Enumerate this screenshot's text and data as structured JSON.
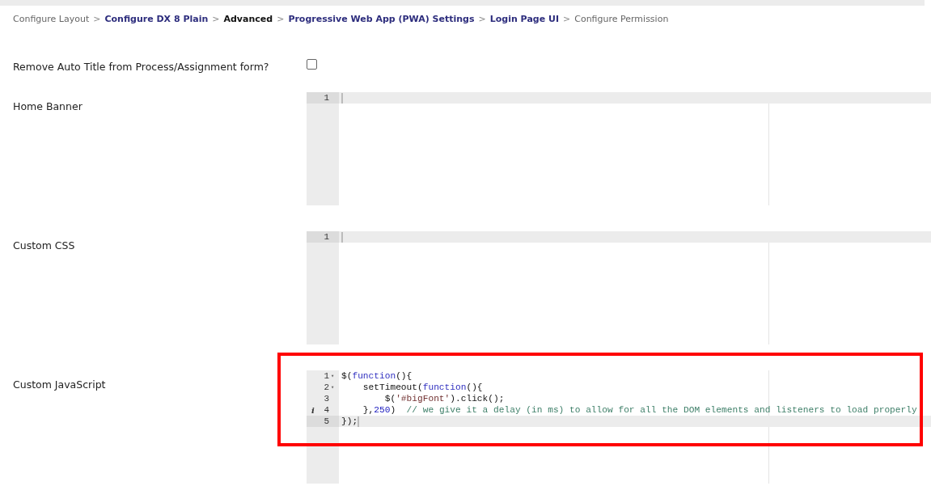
{
  "breadcrumb": [
    {
      "label": "Configure Layout",
      "kind": "plain"
    },
    {
      "label": "Configure DX 8 Plain",
      "kind": "link"
    },
    {
      "label": "Advanced",
      "kind": "current"
    },
    {
      "label": "Progressive Web App (PWA) Settings",
      "kind": "link"
    },
    {
      "label": "Login Page UI",
      "kind": "link"
    },
    {
      "label": "Configure Permission",
      "kind": "plain"
    }
  ],
  "separator": ">",
  "fields": [
    {
      "kind": "checkbox",
      "label": "Remove Auto Title from Process/Assignment form?",
      "checked": false
    },
    {
      "kind": "editor",
      "label": "Home Banner",
      "lines": [
        {
          "number": "1",
          "active": true
        }
      ]
    },
    {
      "kind": "editor",
      "label": "Custom CSS",
      "lines": [
        {
          "number": "1",
          "active": true
        }
      ]
    },
    {
      "kind": "editor",
      "label": "Custom JavaScript",
      "highlighted": true,
      "lines": [
        {
          "number": "1",
          "fold": "▾",
          "active": false,
          "tokens": [
            {
              "text": "$(",
              "kind": "plain"
            },
            {
              "text": "function",
              "kind": "keyword"
            },
            {
              "text": "(){",
              "kind": "plain"
            }
          ]
        },
        {
          "number": "2",
          "fold": "▾",
          "active": false,
          "tokens": [
            {
              "text": "    setTimeout(",
              "kind": "plain"
            },
            {
              "text": "function",
              "kind": "keyword"
            },
            {
              "text": "(){",
              "kind": "plain"
            }
          ]
        },
        {
          "number": "3",
          "active": false,
          "tokens": [
            {
              "text": "        $(",
              "kind": "plain"
            },
            {
              "text": "'#bigFont'",
              "kind": "string"
            },
            {
              "text": ").click();",
              "kind": "plain"
            }
          ]
        },
        {
          "number": "4",
          "info": "i",
          "active": false,
          "tokens": [
            {
              "text": "    },",
              "kind": "plain"
            },
            {
              "text": "250",
              "kind": "number"
            },
            {
              "text": ")  ",
              "kind": "plain"
            },
            {
              "text": "// we give it a delay (in ms) to allow for all the DOM elements and listeners to load properly",
              "kind": "comment"
            }
          ]
        },
        {
          "number": "5",
          "active": true,
          "tokens": [
            {
              "text": "});",
              "kind": "plain"
            }
          ]
        }
      ]
    }
  ]
}
